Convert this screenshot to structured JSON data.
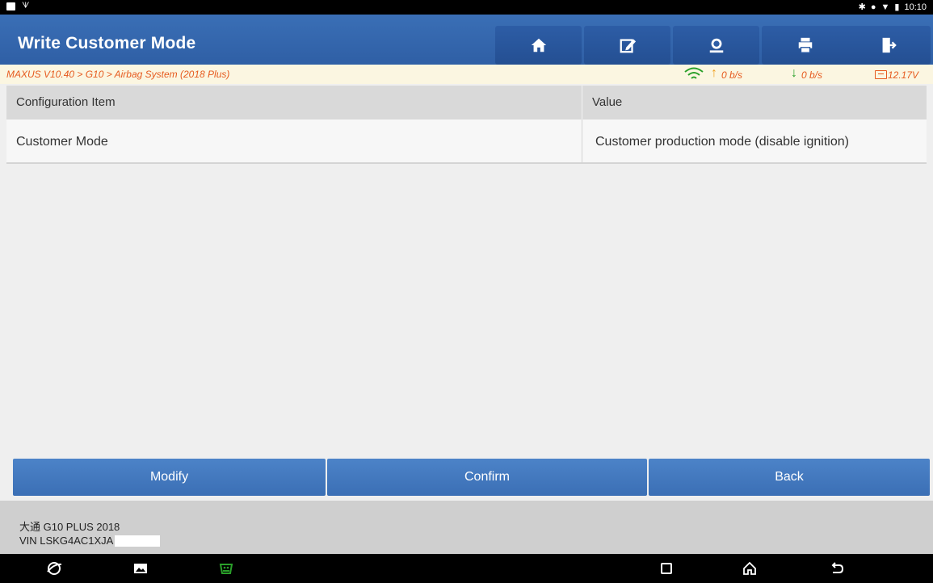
{
  "status_bar": {
    "time": "10:10"
  },
  "header": {
    "title": "Write Customer Mode",
    "toolbar": [
      "home-icon",
      "edit-report-icon",
      "remote-support-icon",
      "print-icon",
      "exit-icon"
    ]
  },
  "breadcrumb": {
    "path": "MAXUS V10.40 > G10 > Airbag System (2018 Plus)",
    "upload_rate": "0 b/s",
    "download_rate": "0 b/s",
    "voltage": "12.17V"
  },
  "table": {
    "headers": {
      "item": "Configuration Item",
      "value": "Value"
    },
    "rows": [
      {
        "item": "Customer Mode",
        "value": "Customer production mode (disable ignition)"
      }
    ]
  },
  "actions": {
    "modify": "Modify",
    "confirm": "Confirm",
    "back": "Back"
  },
  "vehicle": {
    "name": "大通 G10 PLUS 2018",
    "vin": "VIN LSKG4AC1XJA"
  },
  "colors": {
    "header_blue": "#2f5fa5",
    "button_blue": "#3b6fb5",
    "breadcrumb_orange": "#e65a1e",
    "upload_arrow": "#f0a020",
    "download_arrow": "#2aa02a",
    "wifi_green": "#2aa02a"
  }
}
